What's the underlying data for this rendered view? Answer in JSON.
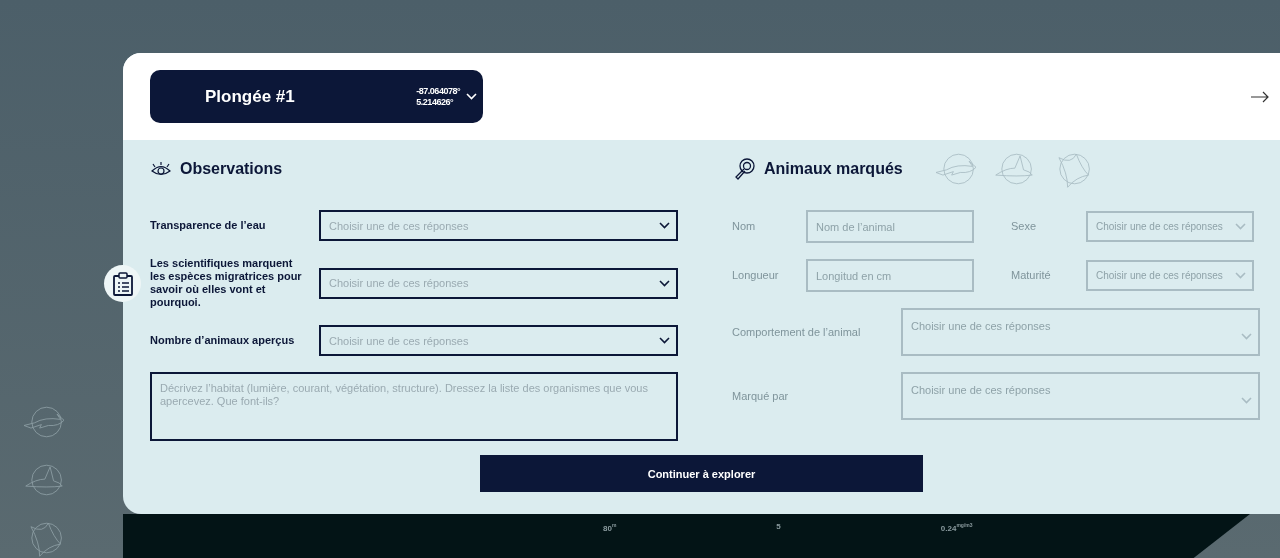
{
  "dive": {
    "title": "Plongée #1",
    "longitude": "-87.064078°",
    "latitude": "5.214626°",
    "expanded": false
  },
  "observations": {
    "title": "Observations",
    "fields": [
      {
        "label": "Transparence de l’eau",
        "placeholder": "Choisir une de ces réponses"
      },
      {
        "label": "Les scientifiques marquent les espèces migratrices pour savoir où elles vont et pourquoi.",
        "placeholder": "Choisir une de ces réponses"
      },
      {
        "label": "Nombre d’animaux aperçus",
        "placeholder": "Choisir une de ces réponses"
      }
    ],
    "habitat": {
      "placeholder": "Décrivez l’habitat (lumière, courant, végétation, structure). Dressez la liste des organismes que vous apercevez. Que font-ils?"
    }
  },
  "tagged_animals": {
    "title": "Animaux marqués",
    "disabled": true,
    "fields": [
      {
        "kind": "input",
        "label": "Nom",
        "placeholder": "Nom de l’animal"
      },
      {
        "kind": "select",
        "label": "Sexe",
        "placeholder": "Choisir une de ces réponses"
      },
      {
        "kind": "input",
        "label": "Longueur",
        "placeholder": "Longitud en cm"
      },
      {
        "kind": "select",
        "label": "Maturité",
        "placeholder": "Choisir une de ces réponses"
      },
      {
        "kind": "tall_select",
        "label": "Comportement de l’animal",
        "placeholder": "Choisir une de ces réponses"
      },
      {
        "kind": "tall_select",
        "label": "Marqué par",
        "placeholder": "Choisir une de ces réponses"
      }
    ]
  },
  "continue_button": "Continuer à explorer",
  "backdrop": {
    "readings": [
      "80$^{m}$",
      "5",
      "0.24$^{mg/m3}$"
    ]
  }
}
